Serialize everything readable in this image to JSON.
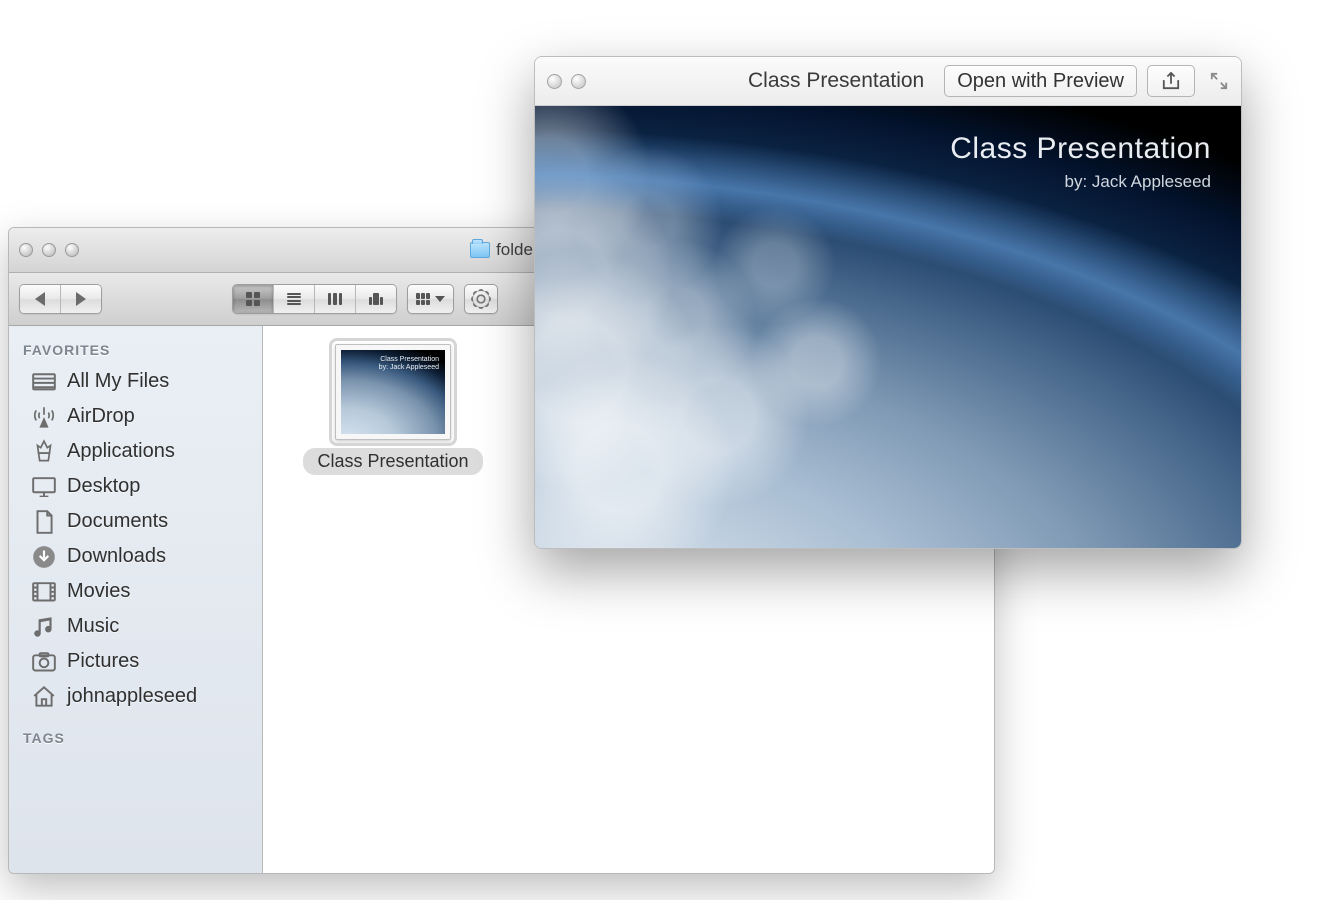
{
  "finder": {
    "window_title": "folde",
    "sidebar": {
      "favorites_heading": "FAVORITES",
      "tags_heading": "TAGS",
      "items": [
        {
          "icon": "all-my-files-icon",
          "label": "All My Files"
        },
        {
          "icon": "airdrop-icon",
          "label": "AirDrop"
        },
        {
          "icon": "applications-icon",
          "label": "Applications"
        },
        {
          "icon": "desktop-icon",
          "label": "Desktop"
        },
        {
          "icon": "documents-icon",
          "label": "Documents"
        },
        {
          "icon": "downloads-icon",
          "label": "Downloads"
        },
        {
          "icon": "movies-icon",
          "label": "Movies"
        },
        {
          "icon": "music-icon",
          "label": "Music"
        },
        {
          "icon": "pictures-icon",
          "label": "Pictures"
        },
        {
          "icon": "home-icon",
          "label": "johnappleseed"
        }
      ]
    },
    "files": [
      {
        "name": "Class Presentation",
        "selected": true
      }
    ]
  },
  "quicklook": {
    "title": "Class Presentation",
    "open_button": "Open with Preview",
    "slide": {
      "title": "Class Presentation",
      "byline": "by: Jack Appleseed"
    }
  }
}
